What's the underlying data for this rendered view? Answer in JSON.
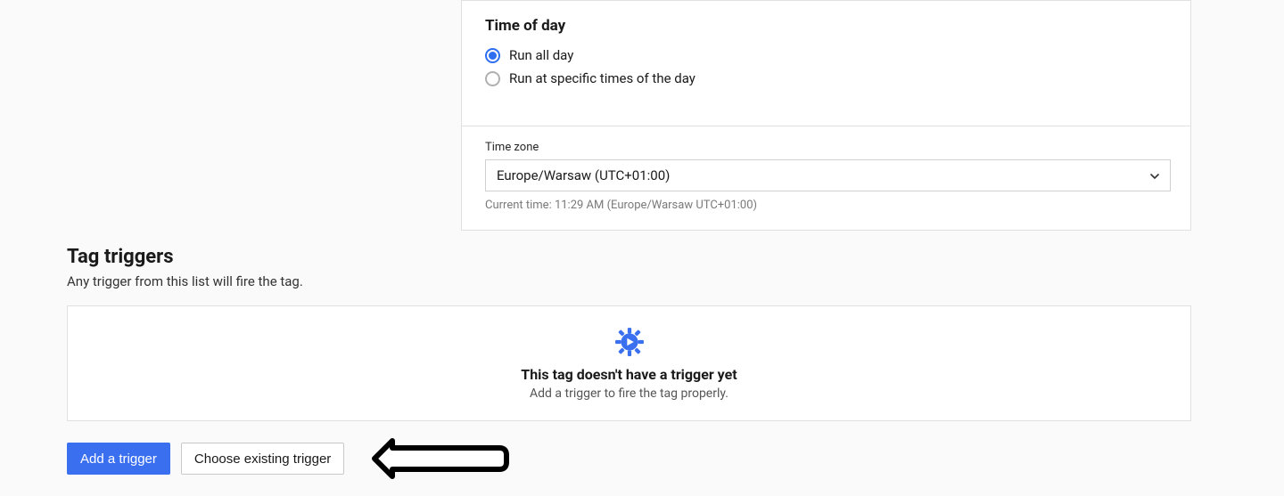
{
  "timeOfDay": {
    "heading": "Time of day",
    "options": {
      "runAllDay": "Run all day",
      "runSpecific": "Run at specific times of the day"
    },
    "selected": "runAllDay"
  },
  "timeZone": {
    "label": "Time zone",
    "value": "Europe/Warsaw (UTC+01:00)",
    "helper": "Current time: 11:29 AM (Europe/Warsaw UTC+01:00)"
  },
  "triggers": {
    "heading": "Tag triggers",
    "subheading": "Any trigger from this list will fire the tag.",
    "empty_title": "This tag doesn't have a trigger yet",
    "empty_subtitle": "Add a trigger to fire the tag properly.",
    "add_button": "Add a trigger",
    "choose_button": "Choose existing trigger"
  }
}
